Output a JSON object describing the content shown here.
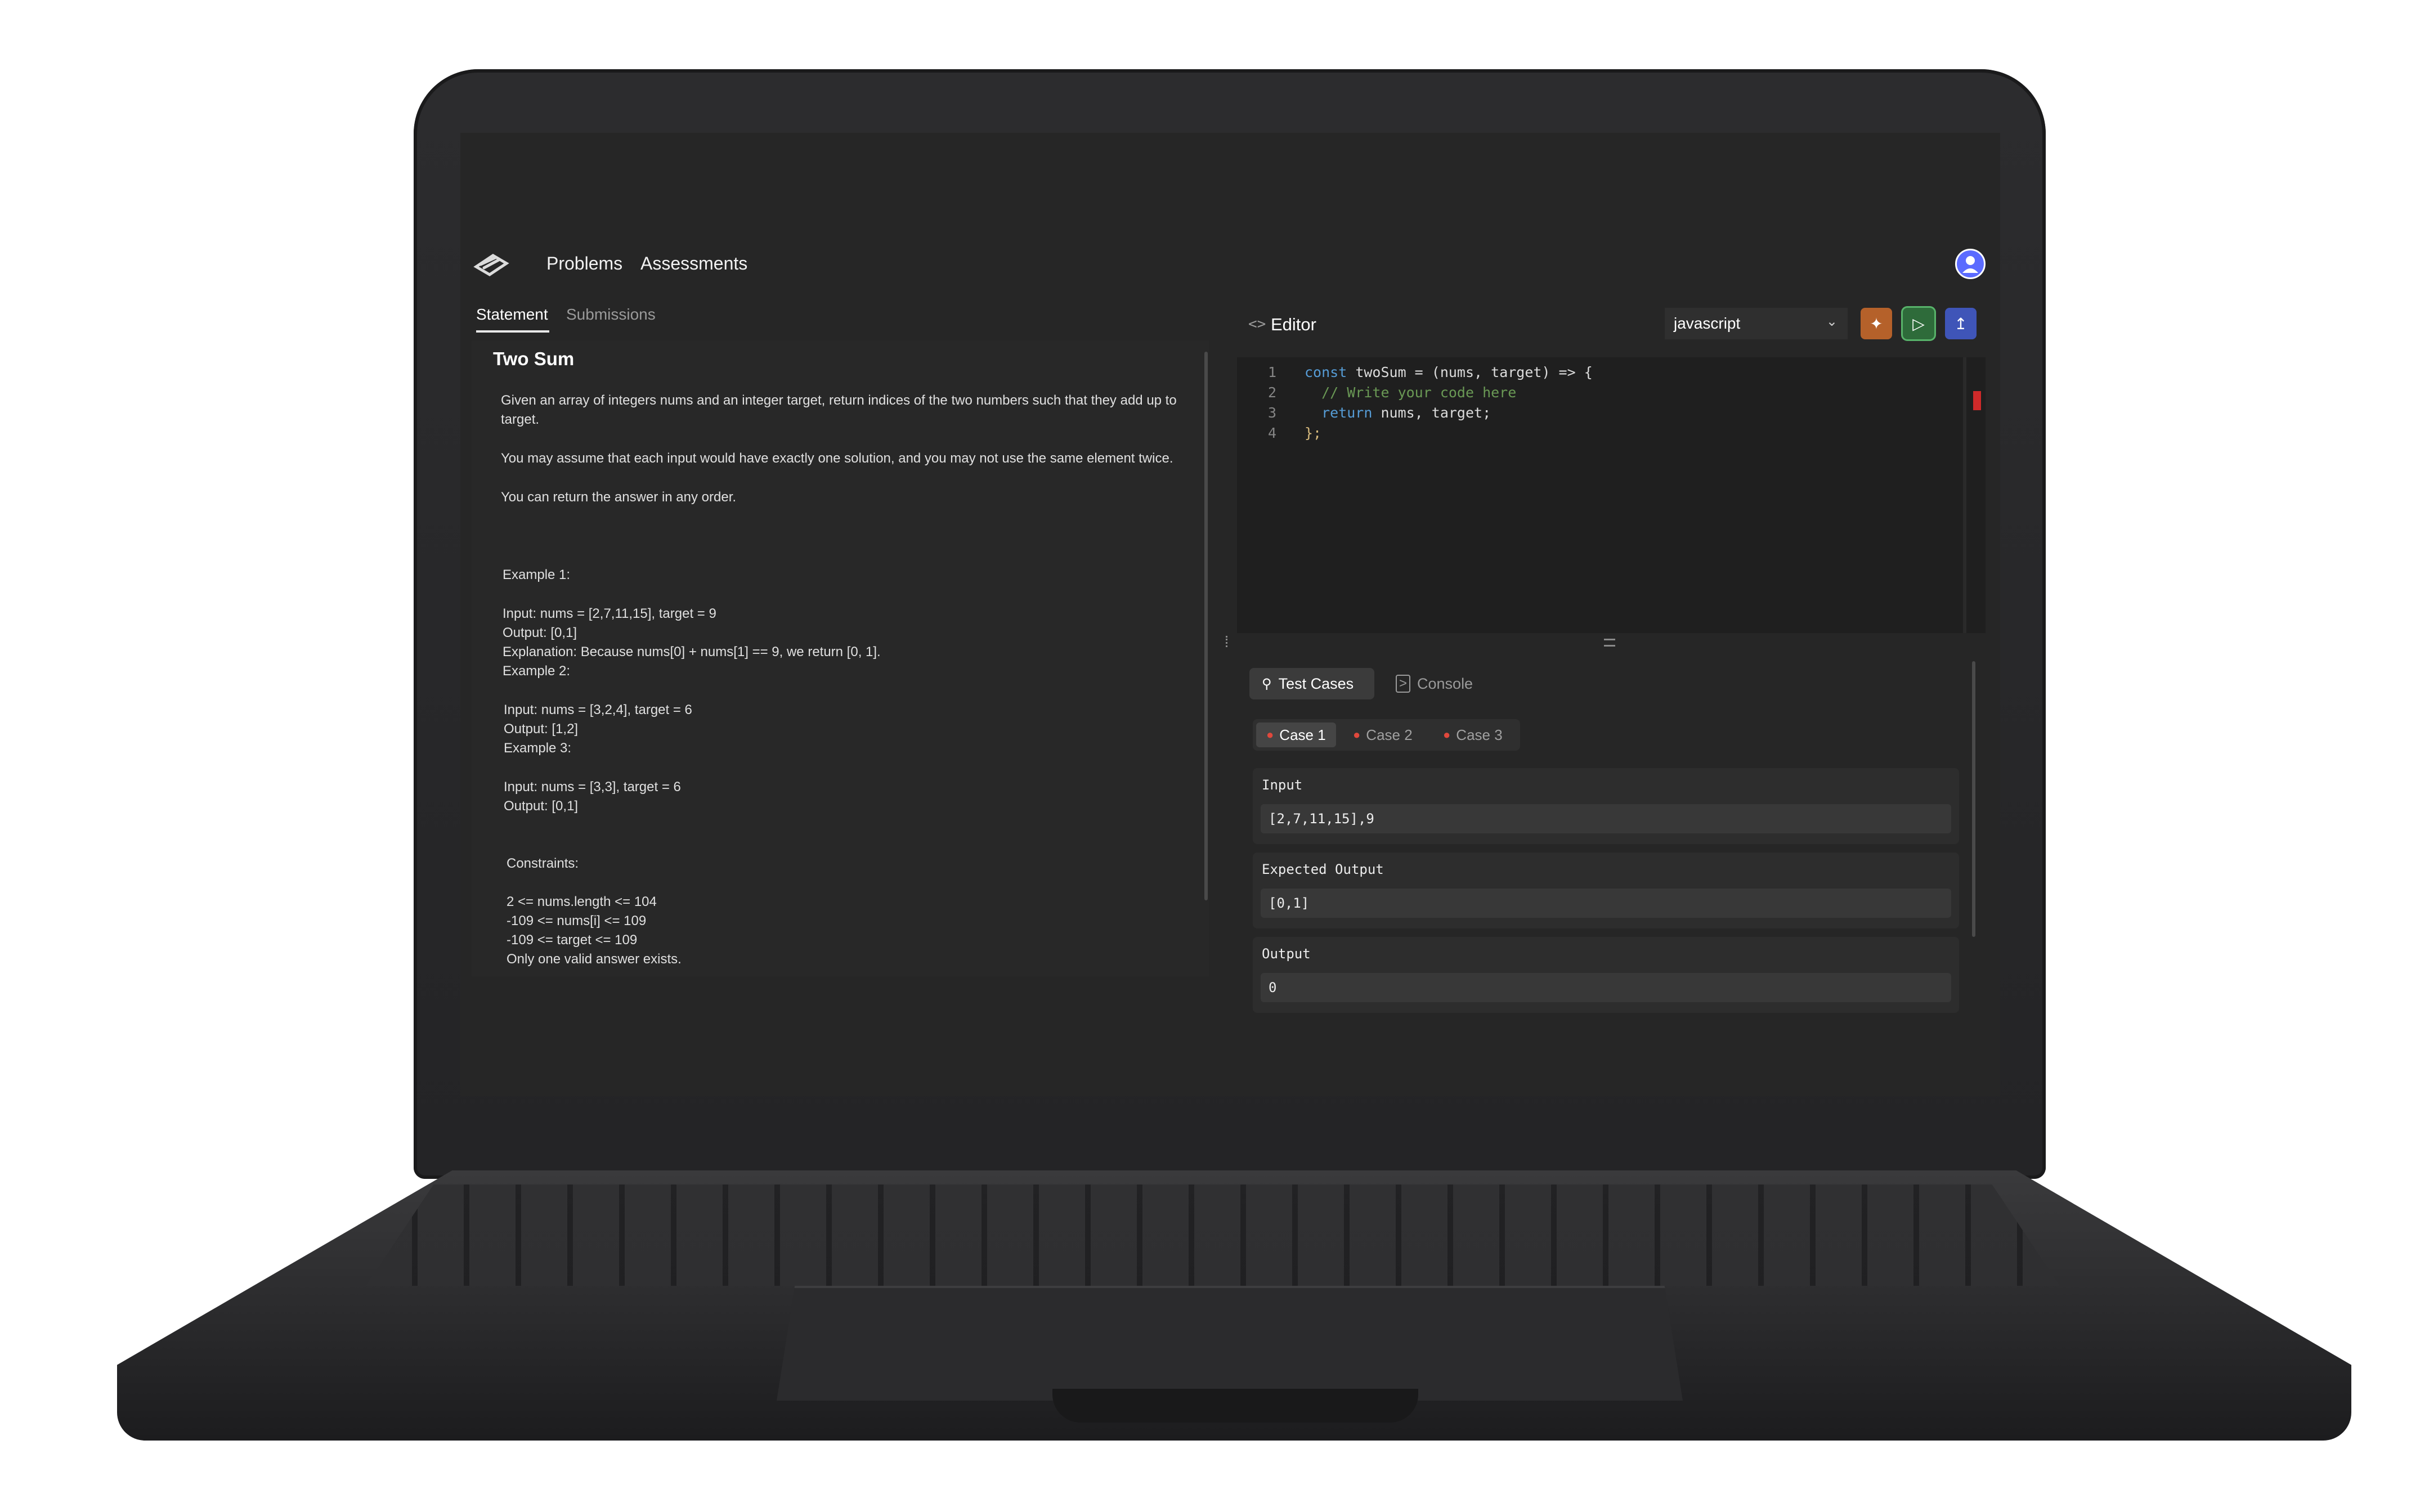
{
  "nav": {
    "links": [
      "Problems",
      "Assessments"
    ]
  },
  "left": {
    "tabs": [
      "Statement",
      "Submissions"
    ],
    "problem_title": "Two Sum",
    "statement": [
      "Given an array of integers nums and an integer target, return indices of the two numbers such that they add up to",
      "target.",
      "You may assume that each input would have exactly one solution, and you may not use the same element twice.",
      "You can return the answer in any order."
    ],
    "examples": [
      "Example 1:",
      "Input: nums = [2,7,11,15], target = 9",
      "Output: [0,1]",
      "Explanation: Because nums[0] + nums[1] == 9, we return [0, 1].",
      "Example 2:",
      "Input: nums = [3,2,4], target = 6",
      "Output: [1,2]",
      "Example 3:",
      "Input: nums = [3,3], target = 6",
      "Output: [0,1]"
    ],
    "constraints_heading": "Constraints:",
    "constraints": [
      "2 <= nums.length <= 104",
      "-109 <= nums[i] <= 109",
      "-109 <= target <= 109",
      "Only one valid answer exists."
    ]
  },
  "editor": {
    "title": "Editor",
    "language": "javascript",
    "line_numbers": [
      "1",
      "2",
      "3",
      "4"
    ],
    "code": {
      "line1_kw": "const",
      "line1_rest": " twoSum = (nums, target) => {",
      "line2": "  // Write your code here",
      "line3_kw": "  return",
      "line3_rest": " nums, target;",
      "line4": "};"
    }
  },
  "tests": {
    "tabs": [
      "Test Cases",
      "Console"
    ],
    "cases": [
      "Case 1",
      "Case 2",
      "Case 3"
    ],
    "input_label": "Input",
    "input_value": "[2,7,11,15],9",
    "expected_label": "Expected Output",
    "expected_value": "[0,1]",
    "output_label": "Output",
    "output_value": "0"
  },
  "colors": {
    "accent_orange": "#b5612a",
    "accent_green": "#2e6b3a",
    "accent_blue": "#3f55b8",
    "failed_dot": "#e0483c"
  },
  "icons": [
    "logo-icon",
    "code-brackets-icon",
    "chevron-down-icon",
    "sparkle-icon",
    "play-icon",
    "upload-icon",
    "flask-icon",
    "terminal-icon",
    "user-icon"
  ]
}
